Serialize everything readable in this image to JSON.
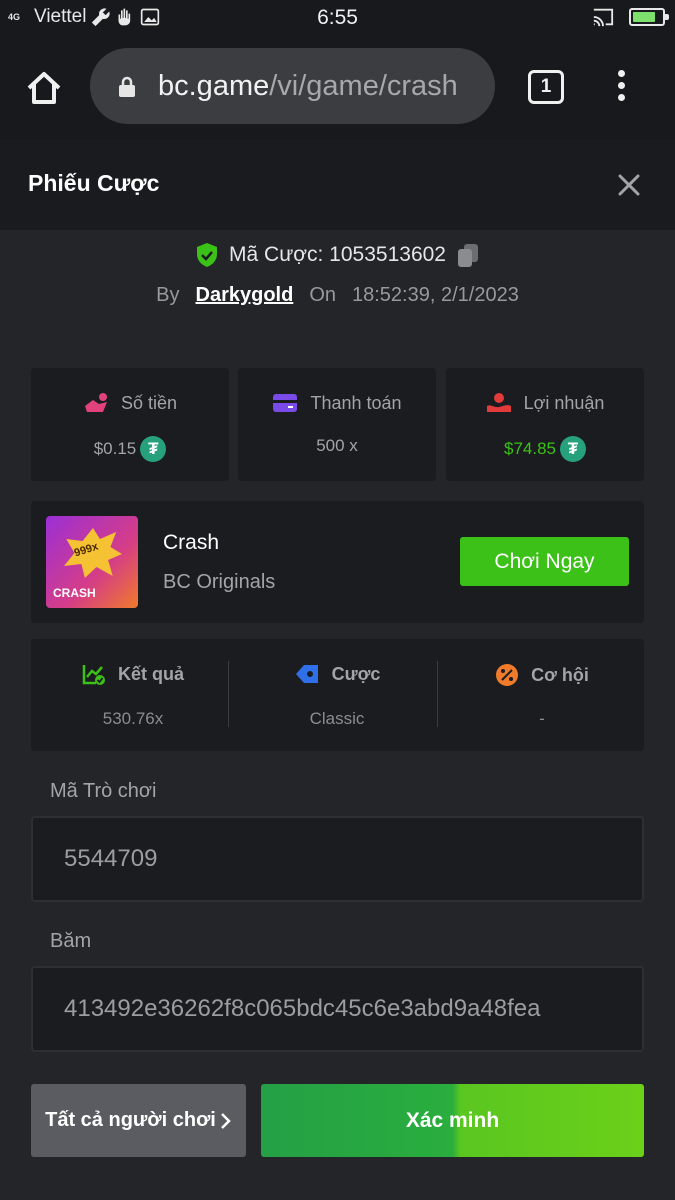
{
  "status_bar": {
    "network_type": "4G",
    "carrier": "Viettel",
    "time": "6:55"
  },
  "browser": {
    "url_host": "bc.game",
    "url_path": "/vi/game/crash",
    "tab_count": "1"
  },
  "dialog": {
    "title": "Phiếu Cược",
    "bet_id_label": "Mã Cược: 1053513602",
    "by_label": "By",
    "username": "Darkygold",
    "on_label": "On",
    "datetime": "18:52:39, 2/1/2023"
  },
  "stats": [
    {
      "label": "Số tiền",
      "value": "$0.15",
      "icon": "bet-amount-icon",
      "value_color": "#a3a4a8"
    },
    {
      "label": "Thanh toán",
      "value": "500 x",
      "icon": "wallet-icon",
      "value_color": "#a3a4a8"
    },
    {
      "label": "Lợi nhuận",
      "value": "$74.85",
      "icon": "profit-icon",
      "value_color": "#3bc117"
    }
  ],
  "game": {
    "thumb_multiplier": "999x",
    "thumb_label": "CRASH",
    "name": "Crash",
    "provider": "BC Originals",
    "play_label": "Chơi Ngay"
  },
  "results": [
    {
      "label": "Kết quả",
      "value": "530.76x",
      "icon": "chart-check-icon"
    },
    {
      "label": "Cược",
      "value": "Classic",
      "icon": "bet-tag-icon"
    },
    {
      "label": "Cơ hội",
      "value": "-",
      "icon": "percent-icon"
    }
  ],
  "fields": {
    "game_id_label": "Mã Trò chơi",
    "game_id_value": "5544709",
    "hash_label": "Băm",
    "hash_value": "413492e36262f8c065bdc45c6e3abd9a48fea"
  },
  "actions": {
    "all_players_label": "Tất cả người chơi",
    "verify_label": "Xác minh"
  },
  "colors": {
    "accent_green": "#3bc117",
    "background": "#232529",
    "card": "#1b1c1f"
  }
}
